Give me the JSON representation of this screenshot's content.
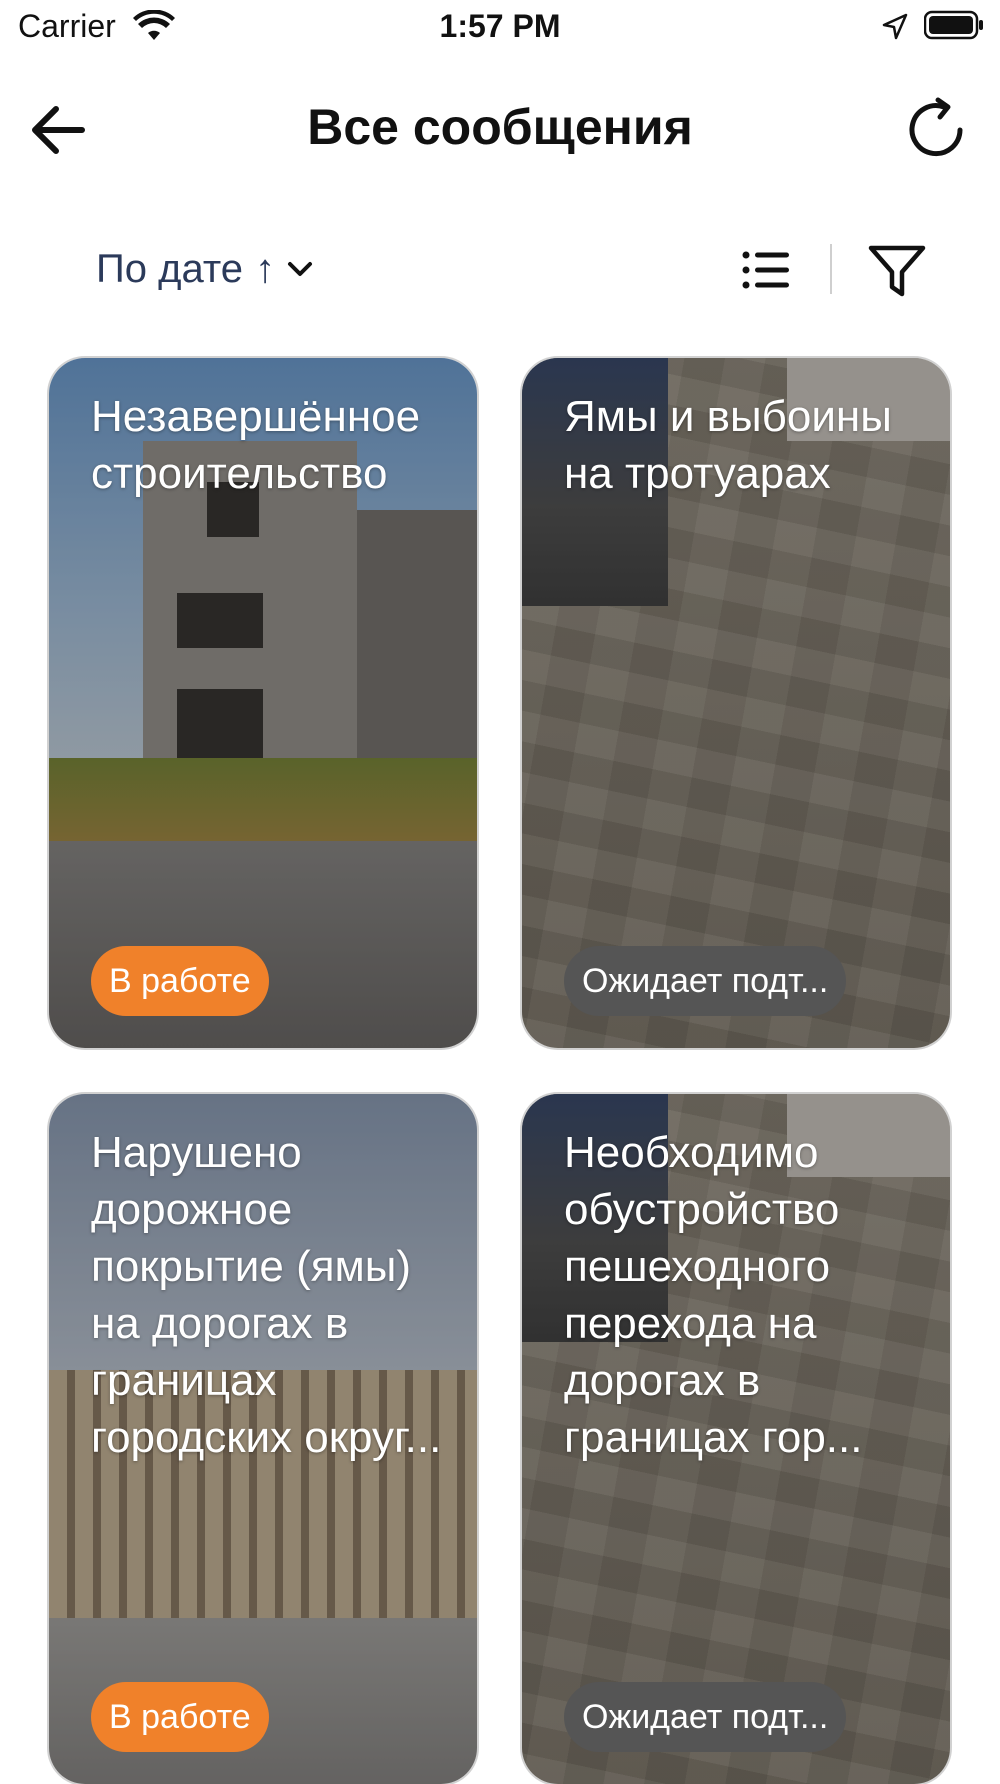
{
  "status_bar": {
    "carrier": "Carrier",
    "time": "1:57 PM",
    "icons": [
      "wifi-icon",
      "location-arrow-icon",
      "battery-icon"
    ]
  },
  "nav": {
    "title": "Все сообщения",
    "back_icon": "arrow-left-icon",
    "refresh_icon": "refresh-icon"
  },
  "toolbar": {
    "sort_label": "По дате",
    "sort_arrow": "↑",
    "list_icon": "list-icon",
    "filter_icon": "filter-icon"
  },
  "cards": [
    {
      "title": "Незавершённое строительство",
      "status": "В работе",
      "status_color": "#f0812a"
    },
    {
      "title": "Ямы и выбоины на тротуарах",
      "status": "Ожидает подт...",
      "status_color": "#555555"
    },
    {
      "title": "Нарушено дорожное покрытие (ямы) на дорогах в границах городских округ...",
      "status": "В работе",
      "status_color": "#f0812a"
    },
    {
      "title": "Необходимо обустройство пешеходного перехода на дорогах в границах гор...",
      "status": "Ожидает подт...",
      "status_color": "#555555"
    }
  ]
}
